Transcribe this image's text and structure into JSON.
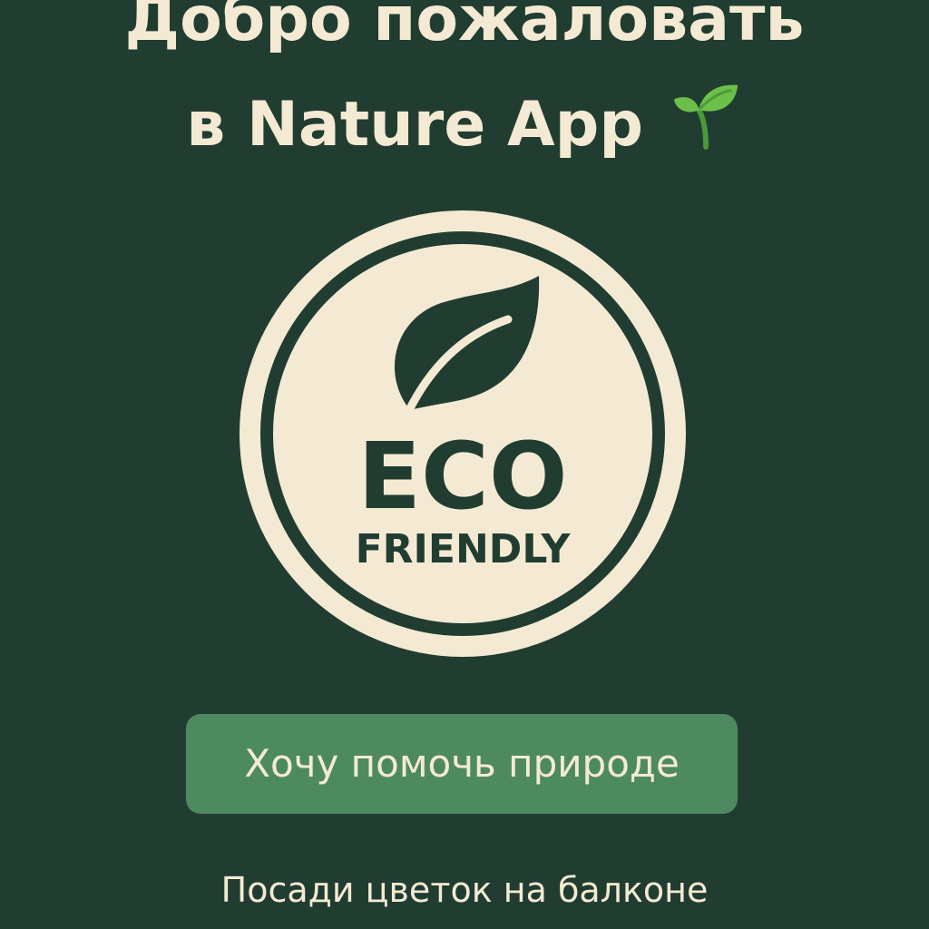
{
  "header": {
    "title_line_1": "Добро пожаловать",
    "title_line_2": "в Nature App",
    "title_icon": "sprout-icon"
  },
  "badge": {
    "icon": "leaf-icon",
    "word_main": "ECO",
    "word_sub": "FRIENDLY"
  },
  "cta": {
    "label": "Хочу помочь природе"
  },
  "footer": {
    "subtitle": "Посади цветок на балконе"
  },
  "colors": {
    "background": "#213d31",
    "text": "#f4ead3",
    "button": "#4e8a5f",
    "badge_fill": "#f4ead3",
    "badge_ink": "#213d31"
  }
}
